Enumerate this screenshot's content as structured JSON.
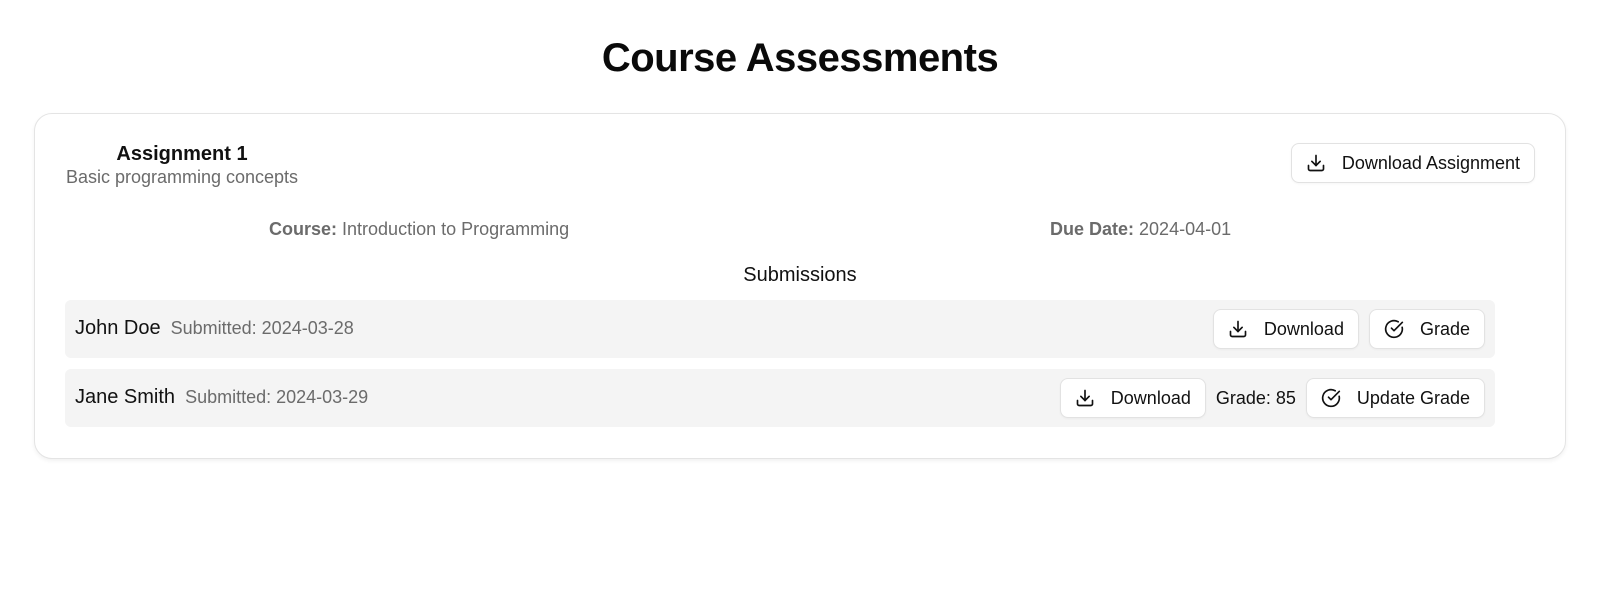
{
  "page": {
    "title": "Course Assessments"
  },
  "assignment": {
    "title": "Assignment 1",
    "description": "Basic programming concepts",
    "download_label": "Download Assignment",
    "course_label": "Course:",
    "course_value": "Introduction to Programming",
    "due_label": "Due Date:",
    "due_value": "2024-04-01"
  },
  "submissions": {
    "title": "Submissions",
    "rows": [
      {
        "student": "John Doe",
        "submitted": "Submitted: 2024-03-28",
        "download_label": "Download",
        "grade_button_label": "Grade"
      },
      {
        "student": "Jane Smith",
        "submitted": "Submitted: 2024-03-29",
        "download_label": "Download",
        "grade_text": "Grade: 85",
        "grade_button_label": "Update Grade"
      }
    ]
  },
  "icons": {
    "download": "download-icon",
    "grade": "check-circle-icon"
  }
}
